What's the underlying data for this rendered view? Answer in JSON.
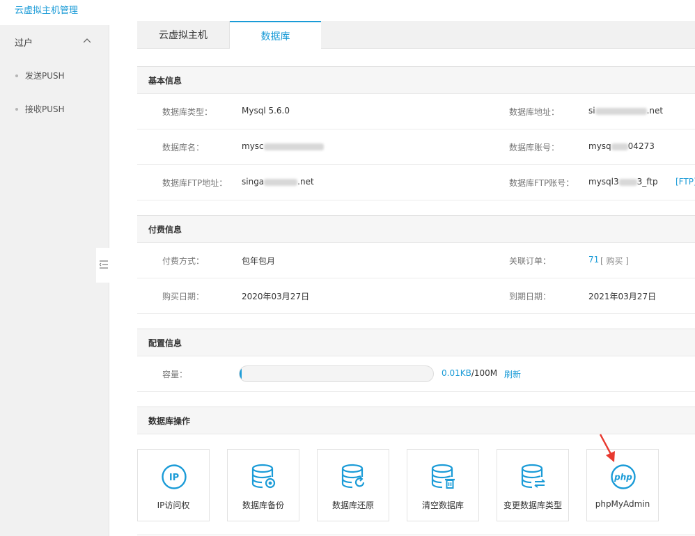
{
  "app": {
    "title": "云虚拟主机管理"
  },
  "sidebar": {
    "group_label": "过户",
    "items": [
      {
        "label": "发送PUSH"
      },
      {
        "label": "接收PUSH"
      }
    ]
  },
  "tabs": [
    {
      "label": "云虚拟主机"
    },
    {
      "label": "数据库"
    }
  ],
  "basic": {
    "title": "基本信息",
    "db_type_label": "数据库类型：",
    "db_type_value": "Mysql 5.6.0",
    "db_addr_label": "数据库地址：",
    "db_addr_prefix": "si",
    "db_addr_suffix": ".net",
    "db_name_label": "数据库名：",
    "db_name_prefix": "mysc",
    "db_account_label": "数据库账号：",
    "db_account_prefix": "mysq",
    "db_account_suffix": "04273",
    "ftp_addr_label": "数据库FTP地址：",
    "ftp_addr_prefix": "singa",
    "ftp_addr_suffix": ".net",
    "ftp_account_label": "数据库FTP账号：",
    "ftp_account_prefix": "mysql3",
    "ftp_account_suffix": "3_ftp",
    "ftp_link": "[FTP]"
  },
  "billing": {
    "title": "付费信息",
    "pay_method_label": "付费方式：",
    "pay_method_value": "包年包月",
    "order_label": "关联订单：",
    "order_value": "71",
    "order_action": "[ 购买 ]",
    "buy_date_label": "购买日期：",
    "buy_date_value": "2020年03月27日",
    "expire_label": "到期日期：",
    "expire_value": "2021年03月27日"
  },
  "config": {
    "title": "配置信息",
    "capacity_label": "容量：",
    "used": "0.01KB",
    "total": "/100M",
    "used_fraction": 0.0001,
    "refresh": "刷新"
  },
  "operations": {
    "title": "数据库操作",
    "items": [
      {
        "label": "IP访问权",
        "icon": "ip-icon"
      },
      {
        "label": "数据库备份",
        "icon": "database-backup-icon"
      },
      {
        "label": "数据库还原",
        "icon": "database-restore-icon"
      },
      {
        "label": "清空数据库",
        "icon": "database-clear-icon"
      },
      {
        "label": "变更数据库类型",
        "icon": "database-change-type-icon"
      },
      {
        "label": "phpMyAdmin",
        "icon": "php-icon"
      }
    ]
  },
  "icons": {
    "ip_text": "IP",
    "php_text": "php"
  },
  "colors": {
    "accent": "#1a9bd7",
    "arrow": "#e8392f"
  }
}
